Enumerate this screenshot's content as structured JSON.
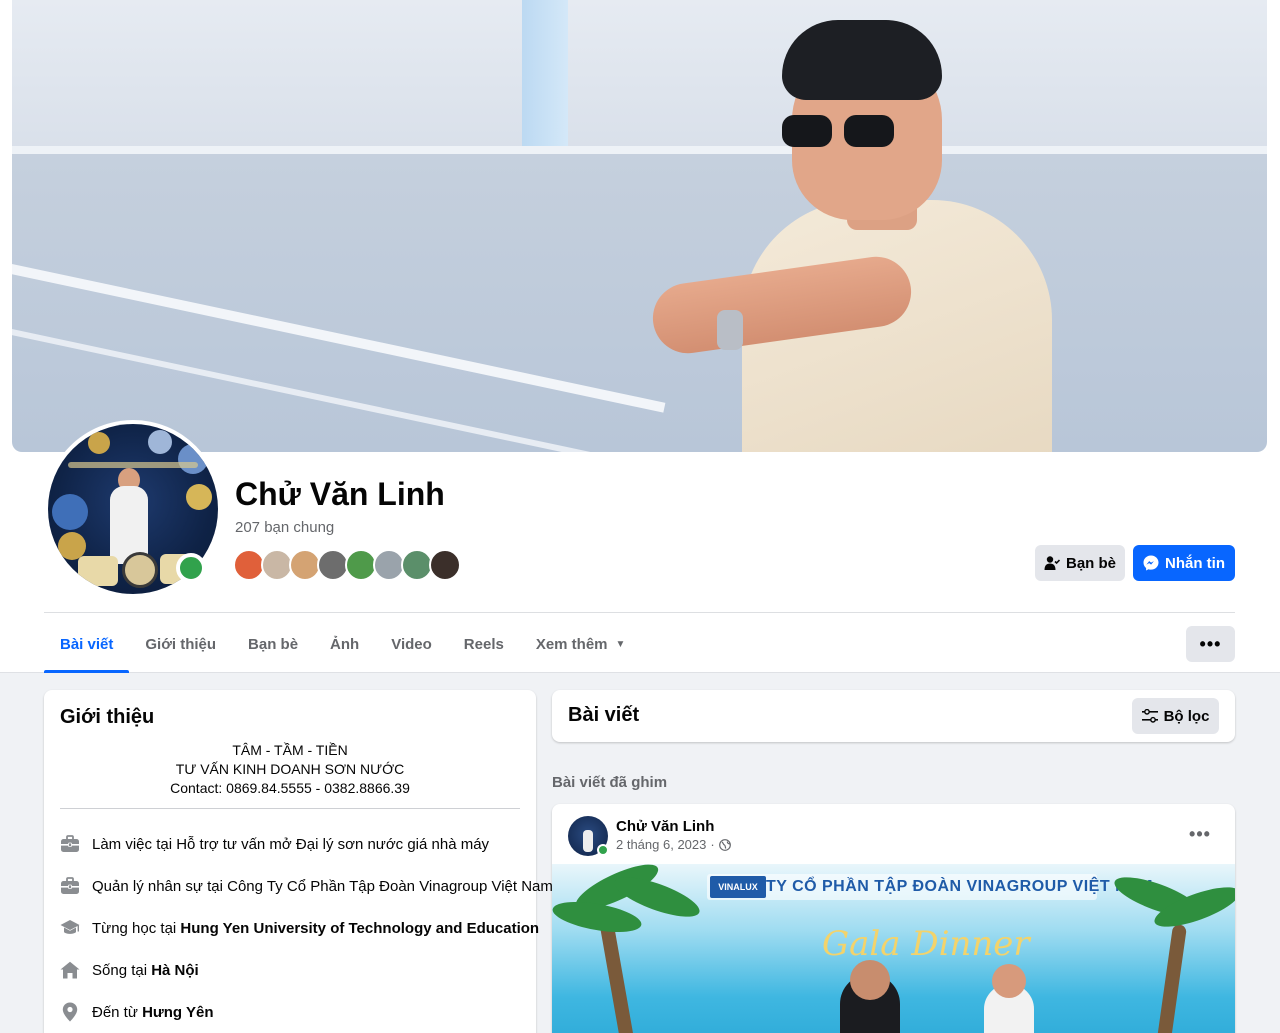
{
  "profile": {
    "name": "Chử Văn Linh",
    "mutual_friends": "207 bạn chung",
    "online": true,
    "friend_face_colors": [
      "#e0603a",
      "#c9b7a5",
      "#d4a373",
      "#6d6d6d",
      "#4f9a4a",
      "#9aa3ab",
      "#5b8f6a",
      "#3b2f2a"
    ]
  },
  "actions": {
    "friends_label": "Bạn bè",
    "message_label": "Nhắn tin",
    "more_label": "•••"
  },
  "tabs": [
    {
      "label": "Bài viết",
      "active": true
    },
    {
      "label": "Giới thiệu"
    },
    {
      "label": "Bạn bè"
    },
    {
      "label": "Ảnh"
    },
    {
      "label": "Video"
    },
    {
      "label": "Reels"
    },
    {
      "label": "Xem thêm"
    }
  ],
  "intro": {
    "title": "Giới thiệu",
    "bio": [
      "TÂM - TẦM - TIỀN",
      "TƯ VẤN KINH DOANH SƠN NƯỚC",
      "Contact: 0869.84.5555 - 0382.8866.39"
    ],
    "items": [
      {
        "icon": "briefcase-icon",
        "text": "Làm việc tại Hỗ trợ tư vấn mở Đại lý sơn nước giá nhà máy",
        "bold": ""
      },
      {
        "icon": "briefcase-icon",
        "text": "Quản lý nhân sự tại Công Ty Cổ Phần Tập Đoàn Vinagroup Việt Nam",
        "bold": ""
      },
      {
        "icon": "graduation-cap-icon",
        "text": "Từng học tại ",
        "bold": "Hung Yen University of Technology and Education"
      },
      {
        "icon": "home-icon",
        "text": "Sống tại ",
        "bold": "Hà Nội"
      },
      {
        "icon": "location-pin-icon",
        "text": "Đến từ ",
        "bold": "Hưng Yên"
      }
    ]
  },
  "posts": {
    "title": "Bài viết",
    "filter_label": "Bộ lọc",
    "pinned_label": "Bài viết đã ghim",
    "pinned_post": {
      "author": "Chử Văn Linh",
      "date": "2 tháng 6, 2023",
      "separator": "·",
      "menu_label": "•••",
      "image_banner": "CÔNG TY CỔ PHẦN TẬP ĐOÀN VINAGROUP VIỆT NAM",
      "image_logo": "VINALUX",
      "image_script": "Gala Dinner"
    }
  },
  "colors": {
    "accent": "#0866ff",
    "online": "#31a24c",
    "secondary_text": "#65676b",
    "button_gray": "#e4e6eb"
  }
}
